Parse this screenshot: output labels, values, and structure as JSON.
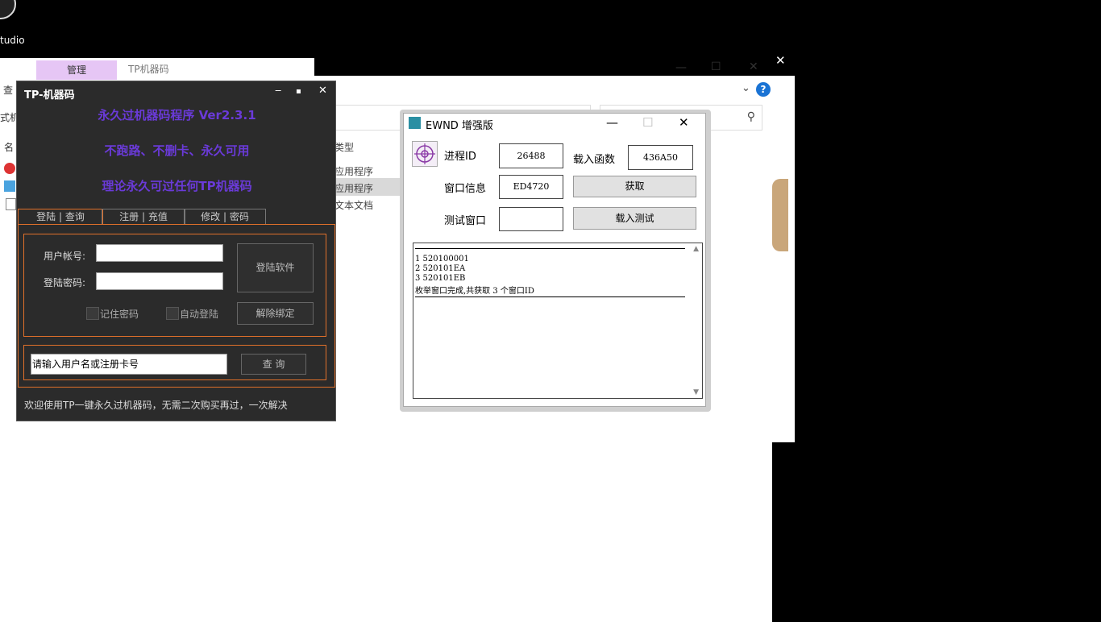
{
  "desktop": {
    "icon_label": "tudio"
  },
  "explorer": {
    "ribbon_tab": "管理",
    "window_name": "TP机器码",
    "left_texts": [
      "查",
      "式机",
      "名"
    ],
    "column_header": "类型",
    "list_types": [
      "应用程序",
      "应用程序",
      "文本文档"
    ],
    "controls": {
      "minimize": "—",
      "maximize": "☐",
      "close": "✕",
      "help": "?",
      "chevron": "⌄",
      "search": "⚲"
    }
  },
  "tp": {
    "title": "TP-机器码",
    "controls": {
      "minimize": "‒",
      "maximize": "▪",
      "close": "✕"
    },
    "headlines": [
      "永久过机器码程序 Ver2.3.1",
      "不跑路、不删卡、永久可用",
      "理论永久可过任何TP机器码"
    ],
    "tabs": [
      "登陆 | 查询",
      "注册 | 充值",
      "修改 | 密码"
    ],
    "account_label": "用户帐号:",
    "password_label": "登陆密码:",
    "login_button": "登陆软件",
    "remember_label": "记住密码",
    "autologin_label": "自动登陆",
    "unbind_button": "解除绑定",
    "query_input": "请输入用户名或注册卡号",
    "query_button": "查 询",
    "footer": "欢迎使用TP一键永久过机器码，无需二次购买再过，一次解决"
  },
  "ewnd": {
    "title": "EWND 增强版",
    "controls": {
      "minimize": "—",
      "maximize": "☐",
      "close": "✕"
    },
    "pid_label": "进程ID",
    "pid_value": "26488",
    "load_func_label": "载入函数",
    "load_func_value": "436A50",
    "window_info_label": "窗口信息",
    "window_info_value": "ED4720",
    "get_button": "获取",
    "test_window_label": "测试窗口",
    "test_window_value": "",
    "load_test_button": "载入测试",
    "log_lines": [
      "1 520100001",
      "2 520101EA",
      "3 520101EB",
      "枚举窗口完成,共获取 3 个窗口ID"
    ]
  }
}
